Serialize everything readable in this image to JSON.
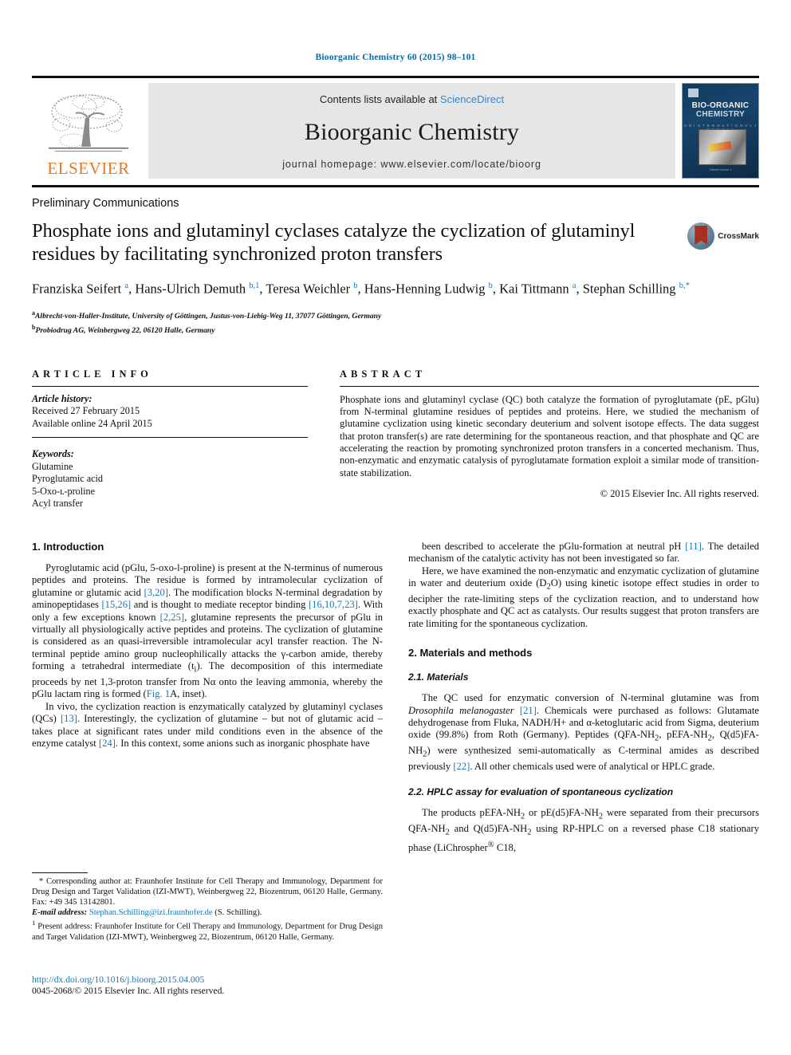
{
  "running_head": "Bioorganic Chemistry 60 (2015) 98–101",
  "header": {
    "contents_prefix": "Contents lists available at ",
    "sciencedirect": "ScienceDirect",
    "journal_name": "Bioorganic Chemistry",
    "homepage": "journal homepage: www.elsevier.com/locate/bioorg",
    "publisher": "ELSEVIER",
    "cover": {
      "line1": "BIO-ORGANIC",
      "line2": "CHEMISTRY",
      "subtitle": "A N   I N T E R N A T I O N A L   J O U R N A L",
      "footer": "Volume number 1"
    },
    "link_color": "#3a86c8"
  },
  "article": {
    "section_type": "Preliminary Communications",
    "title": "Phosphate ions and glutaminyl cyclases catalyze the cyclization of glutaminyl residues by facilitating synchronized proton transfers",
    "crossmark_label": "CrossMark",
    "authors_html": "Franziska Seifert <sup>a</sup>, Hans-Ulrich Demuth <sup>b,1</sup>, Teresa Weichler <sup>b</sup>, Hans-Henning Ludwig <sup>b</sup>, Kai Tittmann <sup>a</sup>, Stephan Schilling <sup>b,*</sup>",
    "affiliations": [
      "Albrecht-von-Haller-Institute, University of Göttingen, Justus-von-Liebig-Weg 11, 37077 Göttingen, Germany",
      "Probiodrug AG, Weinbergweg 22, 06120 Halle, Germany"
    ],
    "affiliation_marks": [
      "a",
      "b"
    ]
  },
  "article_info": {
    "heading": "ARTICLE INFO",
    "history_label": "Article history:",
    "received": "Received 27 February 2015",
    "available_online": "Available online 24 April 2015",
    "keywords_label": "Keywords:",
    "keywords": [
      "Glutamine",
      "Pyroglutamic acid",
      "5-Oxo-ʟ-proline",
      "Acyl transfer"
    ]
  },
  "abstract": {
    "heading": "ABSTRACT",
    "text": "Phosphate ions and glutaminyl cyclase (QC) both catalyze the formation of pyroglutamate (pE, pGlu) from N-terminal glutamine residues of peptides and proteins. Here, we studied the mechanism of glutamine cyclization using kinetic secondary deuterium and solvent isotope effects. The data suggest that proton transfer(s) are rate determining for the spontaneous reaction, and that phosphate and QC are accelerating the reaction by promoting synchronized proton transfers in a concerted mechanism. Thus, non-enzymatic and enzymatic catalysis of pyroglutamate formation exploit a similar mode of transition-state stabilization.",
    "copyright": "© 2015 Elsevier Inc. All rights reserved."
  },
  "body": {
    "left_column": {
      "h_introduction": "1. Introduction",
      "p1_html": "Pyroglutamic acid (pGlu, 5-oxo-<span class=\"sc\">l</span>-proline) is present at the N-terminus of numerous peptides and proteins. The residue is formed by intramolecular cyclization of glutamine or glutamic acid <span class=\"ref\">[3,20]</span>. The modification blocks N-terminal degradation by aminopeptidases <span class=\"ref\">[15,26]</span> and is thought to mediate receptor binding <span class=\"ref\">[16,10,7,23]</span>. With only a few exceptions known <span class=\"ref\">[2,25]</span>, glutamine represents the precursor of pGlu in virtually all physiologically active peptides and proteins. The cyclization of glutamine is considered as an quasi-irreversible intramolecular acyl transfer reaction. The N-terminal peptide amino group nucleophilically attacks the &gamma;-carbon amide, thereby forming a tetrahedral intermediate (t<sub>i</sub>). The decomposition of this intermediate proceeds by net 1,3-proton transfer from N&alpha; onto the leaving ammonia, whereby the pGlu lactam ring is formed (<span class=\"ref\">Fig. 1</span>A, inset).",
      "p2_html": "In vivo, the cyclization reaction is enzymatically catalyzed by glutaminyl cyclases (QCs) <span class=\"ref\">[13]</span>. Interestingly, the cyclization of glutamine &ndash; but not of glutamic acid &ndash; takes place at significant rates under mild conditions even in the absence of the enzyme catalyst <span class=\"ref\">[24]</span>. In this context, some anions such as inorganic phosphate have"
    },
    "right_column": {
      "p1_html": "been described to accelerate the pGlu-formation at neutral pH <span class=\"ref\">[11]</span>. The detailed mechanism of the catalytic activity has not been investigated so far.",
      "p2_html": "Here, we have examined the non-enzymatic and enzymatic cyclization of glutamine in water and deuterium oxide (D<sub>2</sub>O) using kinetic isotope effect studies in order to decipher the rate-limiting steps of the cyclization reaction, and to understand how exactly phosphate and QC act as catalysts. Our results suggest that proton transfers are rate limiting for the spontaneous cyclization.",
      "h_materials": "2. Materials and methods",
      "h_21_materials": "2.1. Materials",
      "p3_html": "The QC used for enzymatic conversion of N-terminal glutamine was from <span class=\"it\">Drosophila melanogaster</span> <span class=\"ref\">[21]</span>. Chemicals were purchased as follows: Glutamate dehydrogenase from Fluka, NADH/H+ and &alpha;-ketoglutaric acid from Sigma, deuterium oxide (99.8%) from Roth (Germany). Peptides (QFA-NH<sub>2</sub>, pEFA-NH<sub>2</sub>, Q(d5)FA-NH<sub>2</sub>) were synthesized semi-automatically as C-terminal amides as described previously <span class=\"ref\">[22]</span>. All other chemicals used were of analytical or HPLC grade.",
      "h_22_hplc": "2.2. HPLC assay for evaluation of spontaneous cyclization",
      "p4_html": "The products pEFA-NH<sub>2</sub> or pE(d5)FA-NH<sub>2</sub> were separated from their precursors QFA-NH<sub>2</sub> and Q(d5)FA-NH<sub>2</sub> using RP-HPLC on a reversed phase C18 stationary phase (LiChrospher<sup>&reg;</sup> C18,"
    }
  },
  "footnotes": {
    "corresponding_html": "<span class=\"lead\">&#42;</span> Corresponding author at: Fraunhofer Institute for Cell Therapy and Immunology, Department for Drug Design and Target Validation (IZI-MWT), Weinbergweg 22, Biozentrum, 06120 Halle, Germany. Fax: +49 345 13142801.",
    "email_html": "<span class=\"fn-em\">E-mail address:</span> <span class=\"link\">Stephan.Schilling@izi.fraunhofer.de</span> (S. Schilling).",
    "present_address_html": "<sup>1</sup> Present address: Fraunhofer Institute for Cell Therapy and Immunology, Department for Drug Design and Target Validation (IZI-MWT), Weinbergweg 22, Biozentrum, 06120 Halle, Germany."
  },
  "footer": {
    "doi": "http://dx.doi.org/10.1016/j.bioorg.2015.04.005",
    "issn_copyright": "0045-2068/© 2015 Elsevier Inc. All rights reserved."
  }
}
